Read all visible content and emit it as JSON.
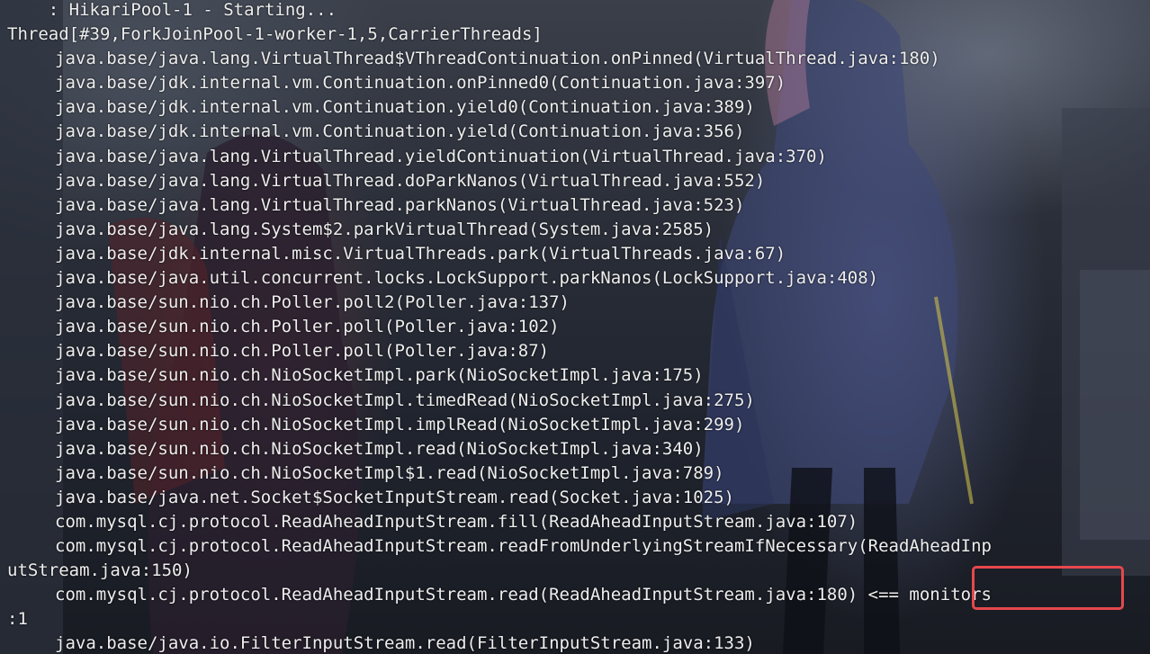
{
  "terminal": {
    "lines": [
      {
        "text": "    : HikariPool-1 - Starting...",
        "indent": false
      },
      {
        "text": "Thread[#39,ForkJoinPool-1-worker-1,5,CarrierThreads]",
        "indent": false
      },
      {
        "text": "java.base/java.lang.VirtualThread$VThreadContinuation.onPinned(VirtualThread.java:180)",
        "indent": true
      },
      {
        "text": "java.base/jdk.internal.vm.Continuation.onPinned0(Continuation.java:397)",
        "indent": true
      },
      {
        "text": "java.base/jdk.internal.vm.Continuation.yield0(Continuation.java:389)",
        "indent": true
      },
      {
        "text": "java.base/jdk.internal.vm.Continuation.yield(Continuation.java:356)",
        "indent": true
      },
      {
        "text": "java.base/java.lang.VirtualThread.yieldContinuation(VirtualThread.java:370)",
        "indent": true
      },
      {
        "text": "java.base/java.lang.VirtualThread.doParkNanos(VirtualThread.java:552)",
        "indent": true
      },
      {
        "text": "java.base/java.lang.VirtualThread.parkNanos(VirtualThread.java:523)",
        "indent": true
      },
      {
        "text": "java.base/java.lang.System$2.parkVirtualThread(System.java:2585)",
        "indent": true
      },
      {
        "text": "java.base/jdk.internal.misc.VirtualThreads.park(VirtualThreads.java:67)",
        "indent": true
      },
      {
        "text": "java.base/java.util.concurrent.locks.LockSupport.parkNanos(LockSupport.java:408)",
        "indent": true
      },
      {
        "text": "java.base/sun.nio.ch.Poller.poll2(Poller.java:137)",
        "indent": true
      },
      {
        "text": "java.base/sun.nio.ch.Poller.poll(Poller.java:102)",
        "indent": true
      },
      {
        "text": "java.base/sun.nio.ch.Poller.poll(Poller.java:87)",
        "indent": true
      },
      {
        "text": "java.base/sun.nio.ch.NioSocketImpl.park(NioSocketImpl.java:175)",
        "indent": true
      },
      {
        "text": "java.base/sun.nio.ch.NioSocketImpl.timedRead(NioSocketImpl.java:275)",
        "indent": true
      },
      {
        "text": "java.base/sun.nio.ch.NioSocketImpl.implRead(NioSocketImpl.java:299)",
        "indent": true
      },
      {
        "text": "java.base/sun.nio.ch.NioSocketImpl.read(NioSocketImpl.java:340)",
        "indent": true
      },
      {
        "text": "java.base/sun.nio.ch.NioSocketImpl$1.read(NioSocketImpl.java:789)",
        "indent": true
      },
      {
        "text": "java.base/java.net.Socket$SocketInputStream.read(Socket.java:1025)",
        "indent": true
      },
      {
        "text": "com.mysql.cj.protocol.ReadAheadInputStream.fill(ReadAheadInputStream.java:107)",
        "indent": true
      },
      {
        "text": "com.mysql.cj.protocol.ReadAheadInputStream.readFromUnderlyingStreamIfNecessary(ReadAheadInp",
        "indent": true
      },
      {
        "text": "utStream.java:150)",
        "indent": false
      },
      {
        "text": "com.mysql.cj.protocol.ReadAheadInputStream.read(ReadAheadInputStream.java:180) <== monitors",
        "indent": true
      },
      {
        "text": ":1",
        "indent": false
      },
      {
        "text": "java.base/java.io.FilterInputStream.read(FilterInputStream.java:133)",
        "indent": true
      }
    ],
    "highlight_color": "#e5484d",
    "text_color": "#eeeeee"
  }
}
